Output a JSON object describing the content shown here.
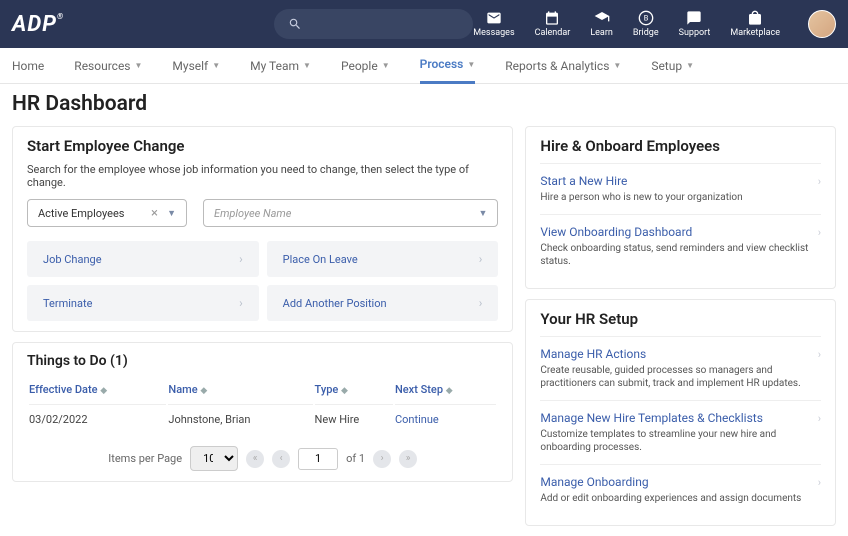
{
  "top": {
    "brand": "ADP",
    "icons": [
      {
        "name": "messages",
        "label": "Messages"
      },
      {
        "name": "calendar",
        "label": "Calendar"
      },
      {
        "name": "learn",
        "label": "Learn"
      },
      {
        "name": "bridge",
        "label": "Bridge"
      },
      {
        "name": "support",
        "label": "Support"
      },
      {
        "name": "marketplace",
        "label": "Marketplace"
      }
    ]
  },
  "nav": {
    "items": [
      "Home",
      "Resources",
      "Myself",
      "My Team",
      "People",
      "Process",
      "Reports & Analytics",
      "Setup"
    ],
    "active": "Process"
  },
  "page_title": "HR Dashboard",
  "start_change": {
    "title": "Start Employee Change",
    "instruction": "Search for the employee whose job information you need to change, then select the type of change.",
    "employee_filter": "Active Employees",
    "employee_name_placeholder": "Employee Name",
    "actions": [
      "Job Change",
      "Place On Leave",
      "Terminate",
      "Add Another Position"
    ]
  },
  "things": {
    "title": "Things to Do (1)",
    "cols": [
      "Effective Date",
      "Name",
      "Type",
      "Next Step"
    ],
    "rows": [
      {
        "date": "03/02/2022",
        "name": "Johnstone, Brian",
        "type": "New Hire",
        "next": "Continue"
      }
    ],
    "pager": {
      "label": "Items per Page",
      "size": "10",
      "page": "1",
      "of": "of 1"
    }
  },
  "hire": {
    "title": "Hire & Onboard Employees",
    "items": [
      {
        "label": "Start a New Hire",
        "desc": "Hire a person who is new to your organization"
      },
      {
        "label": "View Onboarding Dashboard",
        "desc": "Check onboarding status, send reminders and view checklist status."
      }
    ]
  },
  "setup": {
    "title": "Your HR Setup",
    "items": [
      {
        "label": "Manage HR Actions",
        "desc": "Create reusable, guided processes so managers and practitioners can submit, track and implement HR updates."
      },
      {
        "label": "Manage New Hire Templates & Checklists",
        "desc": "Customize templates to streamline your new hire and onboarding processes."
      },
      {
        "label": "Manage Onboarding",
        "desc": "Add or edit onboarding experiences and assign documents"
      }
    ]
  }
}
